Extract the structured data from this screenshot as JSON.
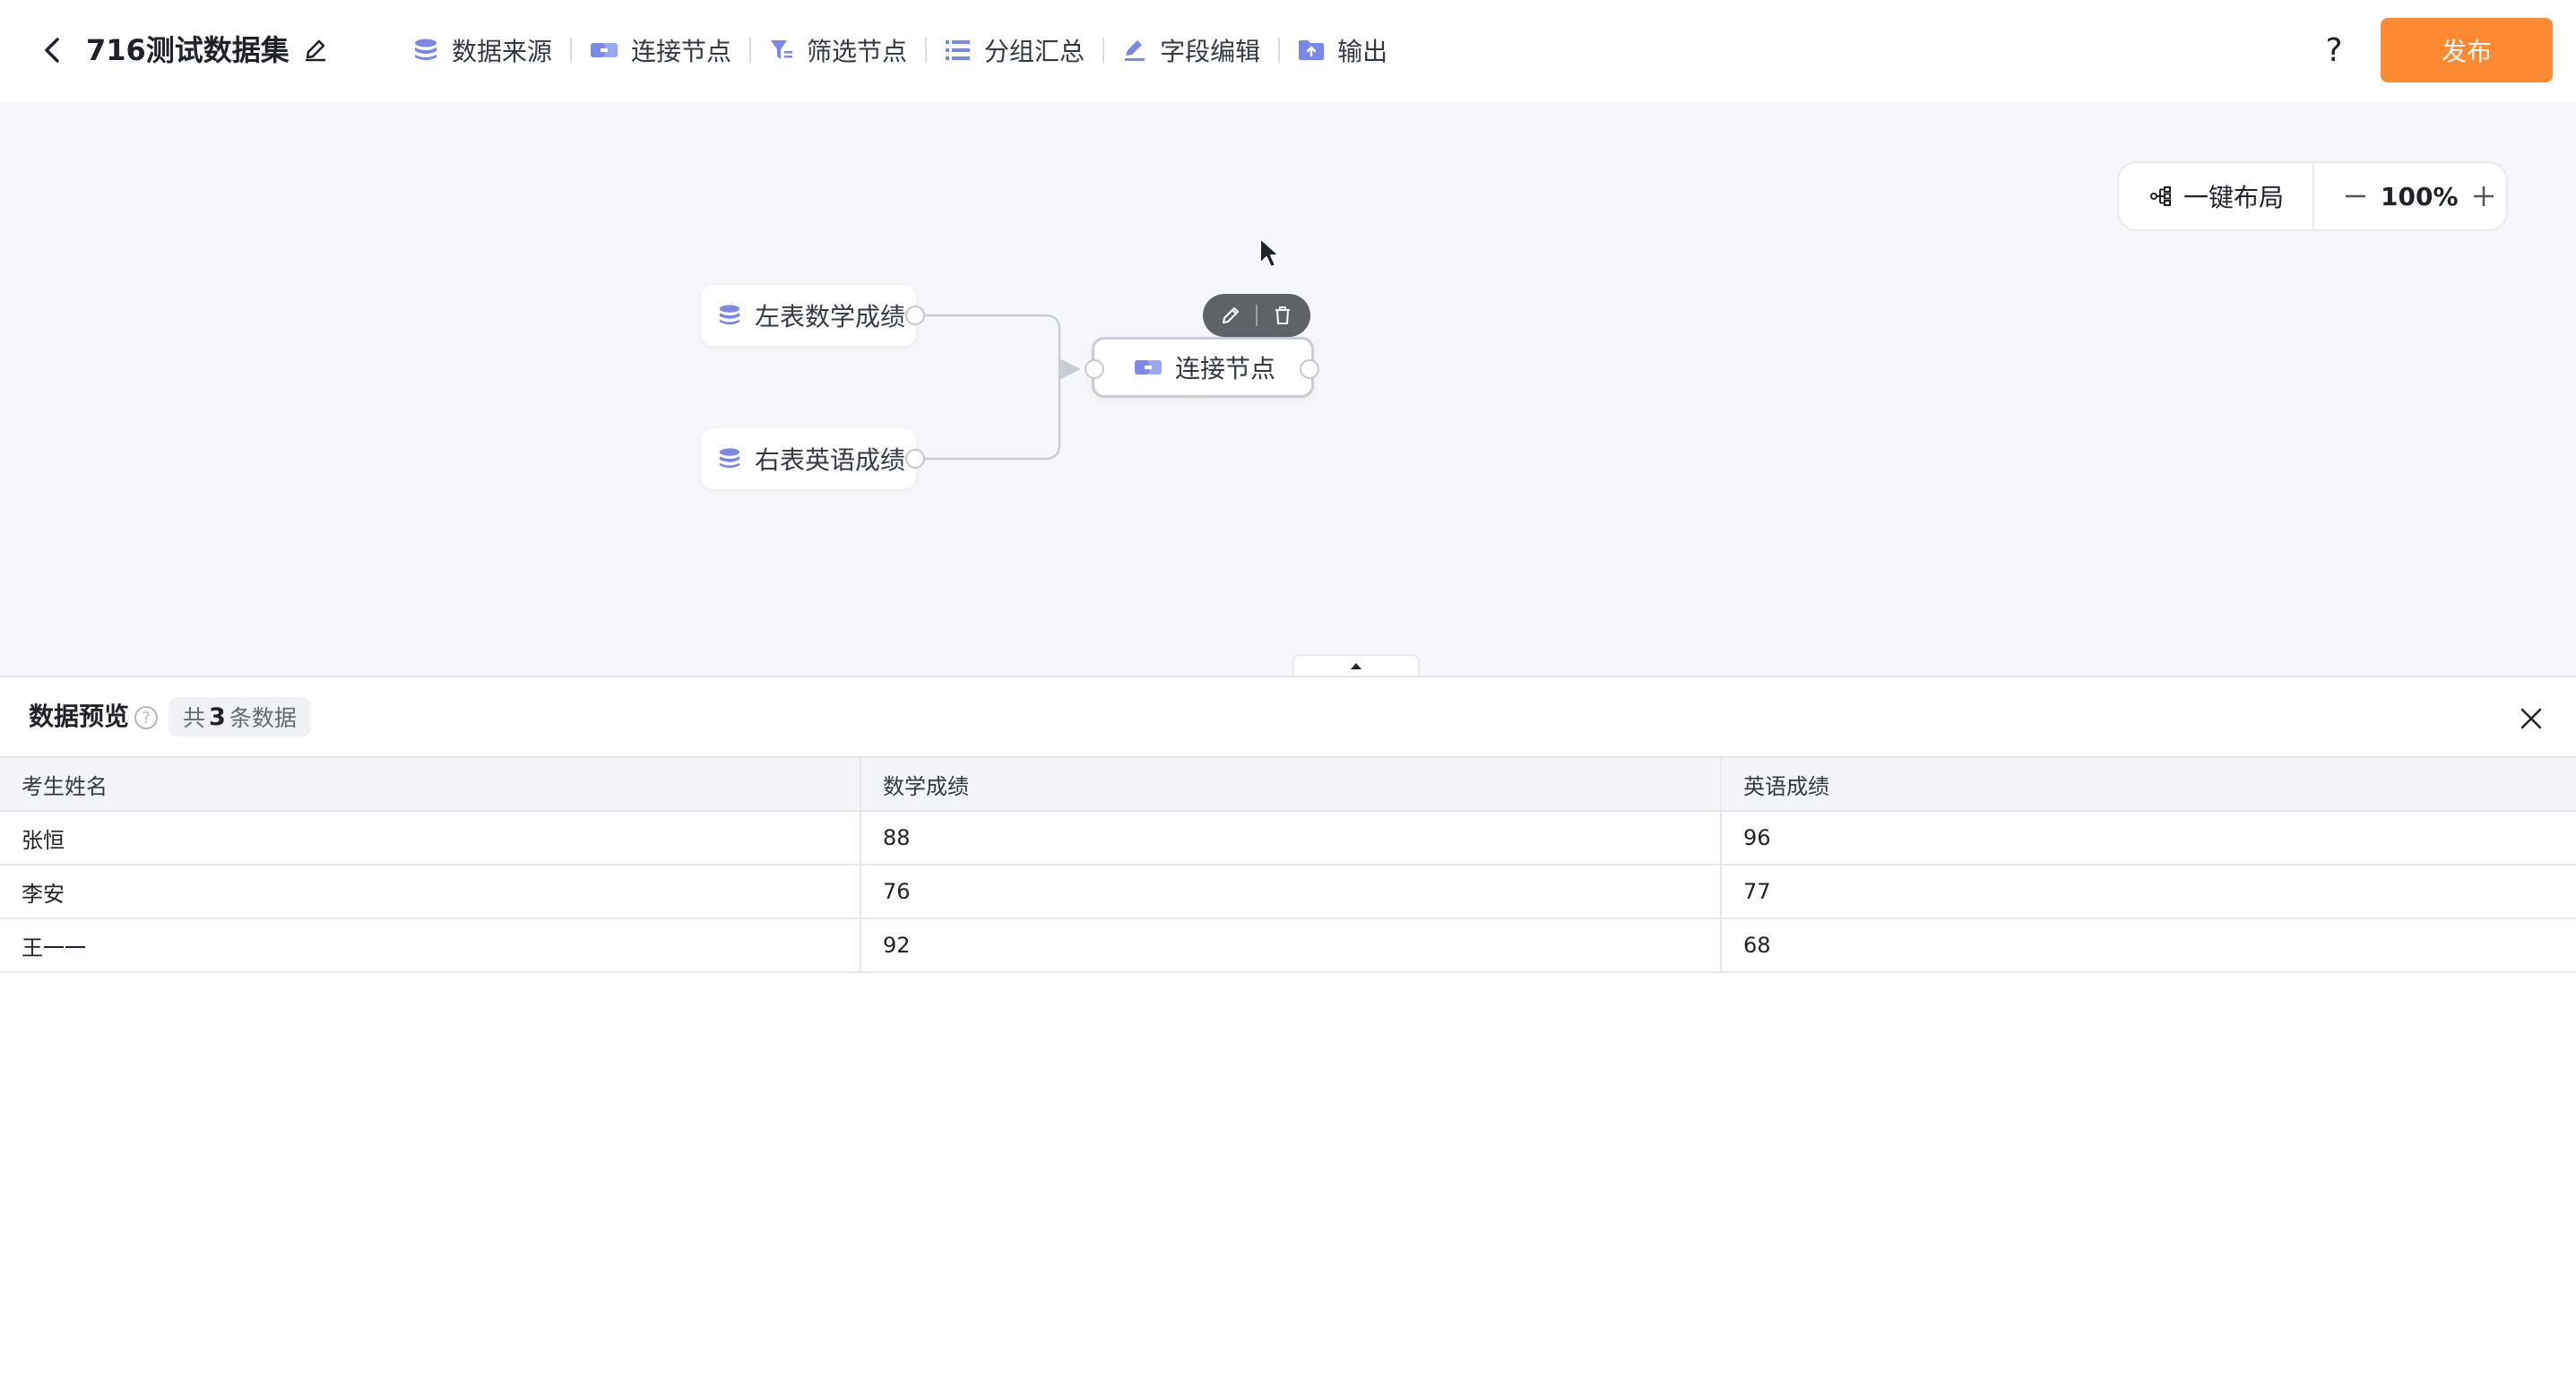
{
  "header": {
    "title": "716测试数据集",
    "toolbar": [
      {
        "label": "数据来源",
        "icon": "database-icon"
      },
      {
        "label": "连接节点",
        "icon": "join-icon"
      },
      {
        "label": "筛选节点",
        "icon": "filter-icon"
      },
      {
        "label": "分组汇总",
        "icon": "group-icon"
      },
      {
        "label": "字段编辑",
        "icon": "edit-field-icon"
      },
      {
        "label": "输出",
        "icon": "output-folder-icon"
      }
    ],
    "help": "?",
    "publish_label": "发布"
  },
  "canvas": {
    "auto_layout_label": "一键布局",
    "zoom": "100%",
    "nodes": {
      "left": "左表数学成绩",
      "right": "右表英语成绩",
      "join": "连接节点"
    }
  },
  "preview": {
    "title": "数据预览",
    "count_prefix": "共",
    "count": "3",
    "count_suffix": "条数据",
    "columns": [
      "考生姓名",
      "数学成绩",
      "英语成绩"
    ],
    "rows": [
      [
        "张恒",
        "88",
        "96"
      ],
      [
        "李安",
        "76",
        "77"
      ],
      [
        "王一一",
        "92",
        "68"
      ]
    ]
  },
  "colors": {
    "accent": "#ff8a34",
    "icon": "#7b88e8",
    "canvas_bg": "#f6f7fa"
  }
}
